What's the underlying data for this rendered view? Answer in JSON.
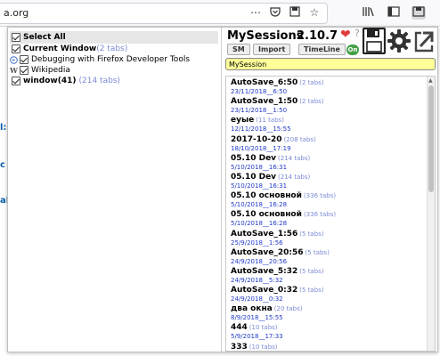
{
  "browser": {
    "url_fragment": "a.org",
    "url_actions": [
      "more-icon",
      "pocket-icon",
      "save-icon",
      "star-icon"
    ],
    "right_icons": [
      "library-icon",
      "sidebar-icon",
      "mysessions-icon"
    ]
  },
  "page_fragments": [
    "l:",
    "c",
    "al"
  ],
  "left_panel": {
    "select_all": "Select All",
    "rows": [
      {
        "label": "Current Window",
        "tabs": "(2 tabs)",
        "bold": true
      },
      {
        "label": "Debugging with Firefox Developer Tools",
        "tabs": "",
        "bold": false,
        "favicon": "firefox-dev-icon"
      },
      {
        "label": "Wikipedia",
        "tabs": "",
        "bold": false,
        "favicon": "wikipedia-icon"
      },
      {
        "label": "window(41)",
        "tabs": "(214 tabs)",
        "bold": true
      }
    ]
  },
  "right_panel": {
    "title": "MySessions",
    "version": "2.10.7",
    "buttons": {
      "sm": "SM",
      "import": "Import",
      "timeline": "TimeLine"
    },
    "toggle": "On",
    "session_name": "MySession",
    "icons": [
      "heart-icon",
      "help-icon",
      "save-session-icon",
      "settings-gear-icon",
      "open-external-icon"
    ]
  },
  "sessions": [
    {
      "name": "AutoSave_6:50",
      "tabs": "(2 tabs)",
      "date": "23/11/2018__6:50"
    },
    {
      "name": "AutoSave_1:50",
      "tabs": "(2 tabs)",
      "date": "23/11/2018__1:50"
    },
    {
      "name": "еуые",
      "tabs": "(11 tabs)",
      "date": "12/11/2018__15:55"
    },
    {
      "name": "2017-10-20",
      "tabs": "(208 tabs)",
      "date": "18/10/2018__17:19"
    },
    {
      "name": "05.10 Dev",
      "tabs": "(214 tabs)",
      "date": "5/10/2018__16:31"
    },
    {
      "name": "05.10 Dev",
      "tabs": "(214 tabs)",
      "date": "5/10/2018__16:31"
    },
    {
      "name": "05.10 основной",
      "tabs": "(336 tabs)",
      "date": "5/10/2018__16:28"
    },
    {
      "name": "05.10 основной",
      "tabs": "(336 tabs)",
      "date": "5/10/2018__16:28"
    },
    {
      "name": "AutoSave_1:56",
      "tabs": "(5 tabs)",
      "date": "25/9/2018__1:56"
    },
    {
      "name": "AutoSave_20:56",
      "tabs": "(5 tabs)",
      "date": "24/9/2018__20:56"
    },
    {
      "name": "AutoSave_5:32",
      "tabs": "(5 tabs)",
      "date": "24/9/2018__5:32"
    },
    {
      "name": "AutoSave_0:32",
      "tabs": "(5 tabs)",
      "date": "24/9/2018__0:32"
    },
    {
      "name": "два окна",
      "tabs": "(20 tabs)",
      "date": "8/9/2018__15:55"
    },
    {
      "name": "444",
      "tabs": "(10 tabs)",
      "date": "5/9/2018__17:33"
    },
    {
      "name": "333",
      "tabs": "(10 tabs)",
      "date": ""
    }
  ],
  "colors": {
    "session_date": "#1f39c7",
    "tab_count": "#7b8ad6",
    "input_bg": "#ffff99",
    "heart": "#e03b3b",
    "toggle_on": "#43a047"
  }
}
